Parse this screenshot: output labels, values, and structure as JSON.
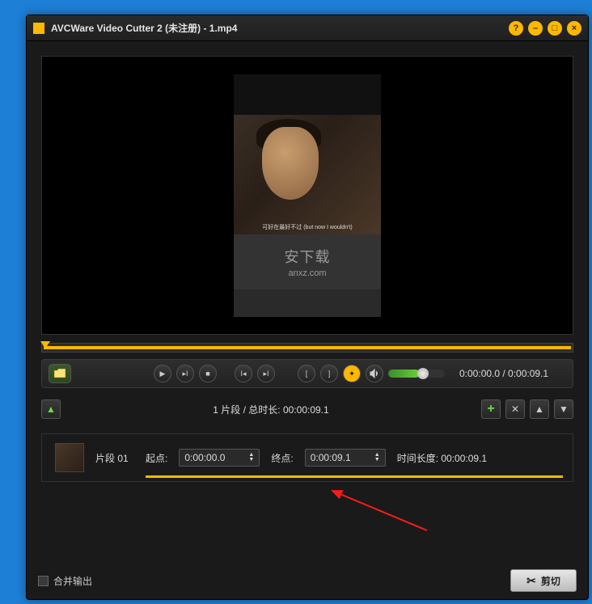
{
  "titlebar": {
    "title": "AVCWare Video Cutter 2 (未注册) - 1.mp4"
  },
  "preview": {
    "subtitle": "可好在最好不过\n(but now I wouldn't)",
    "watermark_big": "安下载",
    "watermark_small": "anxz.com"
  },
  "controls": {
    "time": "0:00:00.0 / 0:00:09.1"
  },
  "segment_header": {
    "info": "1 片段 / 总时长: 00:00:09.1"
  },
  "segment": {
    "name": "片段 01",
    "start_label": "起点:",
    "start_value": "0:00:00.0",
    "end_label": "终点:",
    "end_value": "0:00:09.1",
    "duration_label": "时间长度:",
    "duration_value": "00:00:09.1"
  },
  "bottom": {
    "merge_label": "合并输出",
    "cut_label": "剪切"
  }
}
